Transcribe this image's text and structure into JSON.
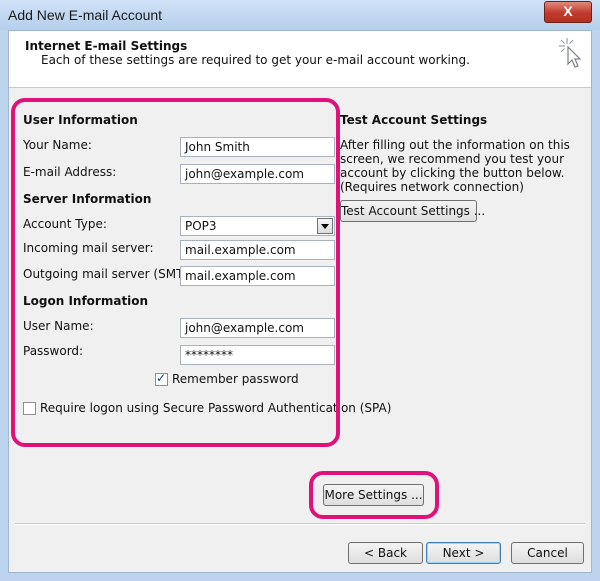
{
  "window": {
    "title": "Add New E-mail Account",
    "close_label": "X"
  },
  "header": {
    "title": "Internet E-mail Settings",
    "subtitle": "Each of these settings are required to get your e-mail account working."
  },
  "user_info": {
    "heading": "User Information",
    "name_label": "Your Name:",
    "name_value": "John Smith",
    "email_label": "E-mail Address:",
    "email_value": "john@example.com"
  },
  "server_info": {
    "heading": "Server Information",
    "account_type_label": "Account Type:",
    "account_type_value": "POP3",
    "incoming_label": "Incoming mail server:",
    "incoming_value": "mail.example.com",
    "outgoing_label": "Outgoing mail server (SMTP):",
    "outgoing_value": "mail.example.com"
  },
  "logon_info": {
    "heading": "Logon Information",
    "username_label": "User Name:",
    "username_value": "john@example.com",
    "password_label": "Password:",
    "password_value": "********",
    "remember_label": "Remember password",
    "remember_checked": true,
    "spa_label": "Require logon using Secure Password Authentication (SPA)",
    "spa_checked": false
  },
  "test_settings": {
    "heading": "Test Account Settings",
    "description": "After filling out the information on this screen, we recommend you test your account by clicking the button below. (Requires network connection)",
    "button_label": "Test Account Settings ..."
  },
  "buttons": {
    "more_settings": "More Settings ...",
    "back": "< Back",
    "next": "Next >",
    "cancel": "Cancel"
  },
  "colors": {
    "highlight": "#e0117a",
    "title_bar": "#b6cfec",
    "close_button": "#c0392b"
  }
}
